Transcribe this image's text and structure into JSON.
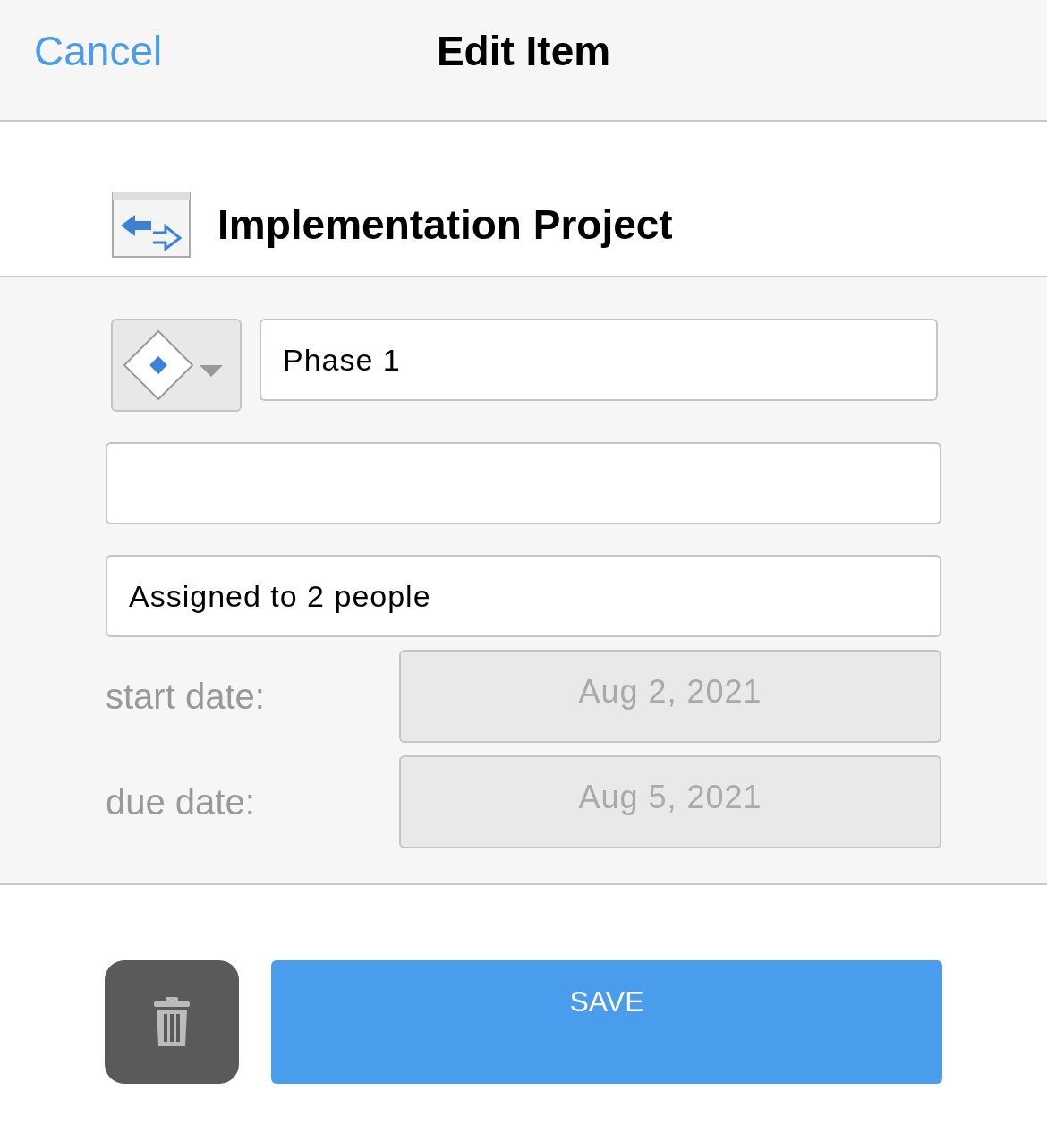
{
  "header": {
    "cancel": "Cancel",
    "title": "Edit Item"
  },
  "project": {
    "name": "Implementation Project"
  },
  "name_field": {
    "value": "Phase 1"
  },
  "assignee_field": {
    "value": "Assigned to 2 people"
  },
  "dates": [
    {
      "label": "start date:",
      "value": "Aug 2, 2021",
      "disabled": true
    },
    {
      "label": "due date:",
      "value": "Aug 5, 2021",
      "disabled": true
    }
  ],
  "save_button": {
    "label": "SAVE"
  }
}
